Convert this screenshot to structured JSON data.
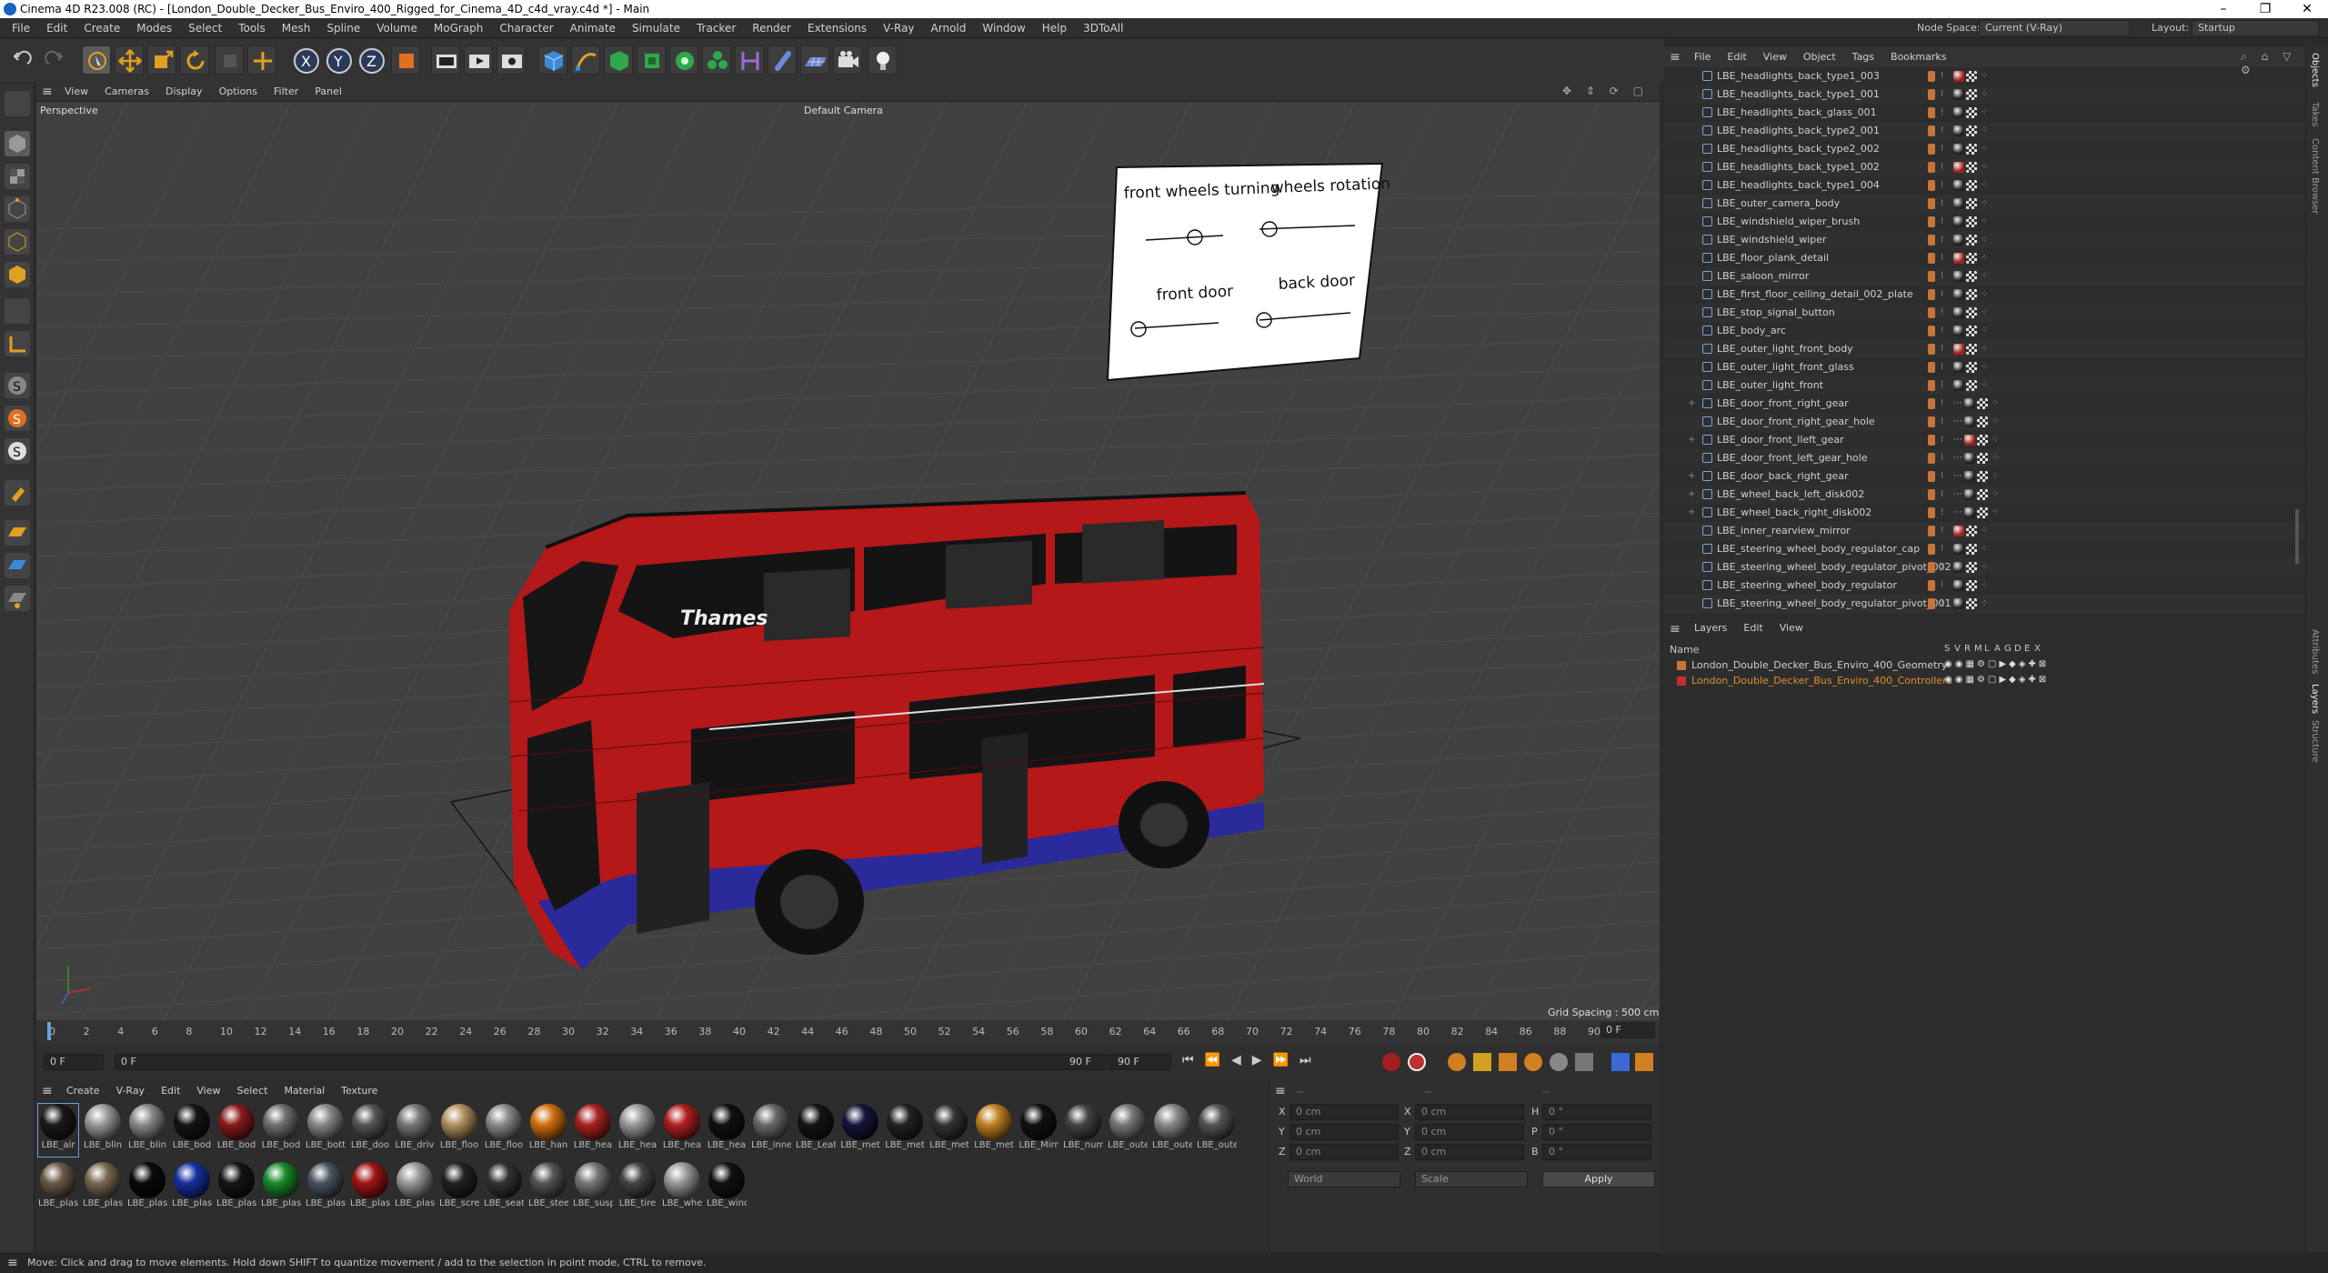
{
  "window": {
    "title": "Cinema 4D R23.008 (RC) - [London_Double_Decker_Bus_Enviro_400_Rigged_for_Cinema_4D_c4d_vray.c4d *] - Main"
  },
  "menubar": [
    "File",
    "Edit",
    "Create",
    "Modes",
    "Select",
    "Tools",
    "Mesh",
    "Spline",
    "Volume",
    "MoGraph",
    "Character",
    "Animate",
    "Simulate",
    "Tracker",
    "Render",
    "Extensions",
    "V-Ray",
    "Arnold",
    "Window",
    "Help",
    "3DToAll"
  ],
  "nodespace": {
    "label": "Node Space:",
    "value": "Current (V-Ray)"
  },
  "layout": {
    "label": "Layout:",
    "value": "Startup"
  },
  "viewport": {
    "menu": [
      "View",
      "Cameras",
      "Display",
      "Options",
      "Filter",
      "Panel"
    ],
    "name": "Perspective",
    "camera": "Default Camera",
    "grid_spacing": "Grid Spacing : 500 cm",
    "controller": {
      "front_wheels": "front wheels turning",
      "wheels_rotation": "wheels rotation",
      "front_door": "front door",
      "back_door": "back door"
    },
    "bus_ad_text": "Thames"
  },
  "timeline": {
    "ticks": [
      "0",
      "2",
      "4",
      "6",
      "8",
      "10",
      "12",
      "14",
      "16",
      "18",
      "20",
      "22",
      "24",
      "26",
      "28",
      "30",
      "32",
      "34",
      "36",
      "38",
      "40",
      "42",
      "44",
      "46",
      "48",
      "50",
      "52",
      "54",
      "56",
      "58",
      "60",
      "62",
      "64",
      "66",
      "68",
      "70",
      "72",
      "74",
      "76",
      "78",
      "80",
      "82",
      "84",
      "86",
      "88",
      "90"
    ],
    "end": "0 F"
  },
  "transport": {
    "current": "0 F",
    "start": "0 F",
    "end1": "90 F",
    "end2": "90 F"
  },
  "materials": {
    "menu": [
      "Create",
      "V-Ray",
      "Edit",
      "View",
      "Select",
      "Material",
      "Texture"
    ],
    "row1": [
      {
        "label": "LBE_air",
        "color": "#1a1a1a"
      },
      {
        "label": "LBE_blin",
        "color": "#9a9a9a"
      },
      {
        "label": "LBE_blin",
        "color": "#8a8a8a"
      },
      {
        "label": "LBE_bod",
        "color": "#151515"
      },
      {
        "label": "LBE_bod",
        "color": "#8a1a1a"
      },
      {
        "label": "LBE_bod",
        "color": "#707070"
      },
      {
        "label": "LBE_bott",
        "color": "#888"
      },
      {
        "label": "LBE_doo",
        "color": "#555"
      },
      {
        "label": "LBE_driv",
        "color": "#777"
      },
      {
        "label": "LBE_floo",
        "color": "#b09060"
      },
      {
        "label": "LBE_floo",
        "color": "#8a8a8a"
      },
      {
        "label": "LBE_han",
        "color": "#d07010"
      },
      {
        "label": "LBE_hea",
        "color": "#aa2222"
      },
      {
        "label": "LBE_hea",
        "color": "#999"
      },
      {
        "label": "LBE_hea",
        "color": "#b02020"
      },
      {
        "label": "LBE_hea",
        "color": "#111"
      },
      {
        "label": "LBE_inne",
        "color": "#6a6a6a"
      },
      {
        "label": "LBE_Leat",
        "color": "#151515"
      },
      {
        "label": "LBE_met",
        "color": "#15153a"
      },
      {
        "label": "LBE_met",
        "color": "#222"
      },
      {
        "label": "LBE_met",
        "color": "#333"
      },
      {
        "label": "LBE_met",
        "color": "#c08020"
      },
      {
        "label": "LBE_Mirr",
        "color": "#111"
      },
      {
        "label": "LBE_num",
        "color": "#444"
      },
      {
        "label": "LBE_oute",
        "color": "#777"
      },
      {
        "label": "LBE_oute",
        "color": "#888"
      },
      {
        "label": "LBE_oute",
        "color": "#555"
      }
    ],
    "row2": [
      {
        "label": "LBE_plas",
        "color": "#6a5a48"
      },
      {
        "label": "LBE_plas",
        "color": "#7a6a50"
      },
      {
        "label": "LBE_plas",
        "color": "#0a0a0a"
      },
      {
        "label": "LBE_plas",
        "color": "#1530a0"
      },
      {
        "label": "LBE_plas",
        "color": "#151515"
      },
      {
        "label": "LBE_plas",
        "color": "#1a8a2a"
      },
      {
        "label": "LBE_plas",
        "color": "#4a5560"
      },
      {
        "label": "LBE_plas",
        "color": "#a01515"
      },
      {
        "label": "LBE_plas",
        "color": "#999"
      },
      {
        "label": "LBE_scre",
        "color": "#222"
      },
      {
        "label": "LBE_seat",
        "color": "#333"
      },
      {
        "label": "LBE_stee",
        "color": "#555"
      },
      {
        "label": "LBE_susp",
        "color": "#777"
      },
      {
        "label": "LBE_tire",
        "color": "#444"
      },
      {
        "label": "LBE_whe",
        "color": "#999"
      },
      {
        "label": "LBE_wind",
        "color": "#111"
      }
    ]
  },
  "coords": {
    "header": [
      "--",
      "--",
      "--"
    ],
    "rows": [
      {
        "a": "X",
        "av": "0 cm",
        "b": "X",
        "bv": "0 cm",
        "c": "H",
        "cv": "0 °"
      },
      {
        "a": "Y",
        "av": "0 cm",
        "b": "Y",
        "bv": "0 cm",
        "c": "P",
        "cv": "0 °"
      },
      {
        "a": "Z",
        "av": "0 cm",
        "b": "Z",
        "bv": "0 cm",
        "c": "B",
        "cv": "0 °"
      }
    ],
    "mode1": "World",
    "mode2": "Scale",
    "apply": "Apply"
  },
  "objects": {
    "menu": [
      "File",
      "Edit",
      "View",
      "Object",
      "Tags",
      "Bookmarks"
    ],
    "items": [
      "LBE_headlights_back_type1_003",
      "LBE_headlights_back_type1_001",
      "LBE_headlights_back_glass_001",
      "LBE_headlights_back_type2_001",
      "LBE_headlights_back_type2_002",
      "LBE_headlights_back_type1_002",
      "LBE_headlights_back_type1_004",
      "LBE_outer_camera_body",
      "LBE_windshield_wiper_brush",
      "LBE_windshield_wiper",
      "LBE_floor_plank_detail",
      "LBE_saloon_mirror",
      "LBE_first_floor_ceiling_detail_002_plate",
      "LBE_stop_signal_button",
      "LBE_body_arc",
      "LBE_outer_light_front_body",
      "LBE_outer_light_front_glass",
      "LBE_outer_light_front",
      "LBE_door_front_right_gear",
      "LBE_door_front_right_gear_hole",
      "LBE_door_front_lleft_gear",
      "LBE_door_front_left_gear_hole",
      "LBE_door_back_right_gear",
      "LBE_wheel_back_left_disk002",
      "LBE_wheel_back_right_disk002",
      "LBE_inner_rearview_mirror",
      "LBE_steering_wheel_body_regulator_cap",
      "LBE_steering_wheel_body_regulator_pivot_002",
      "LBE_steering_wheel_body_regulator",
      "LBE_steering_wheel_body_regulator_pivot_001"
    ]
  },
  "layers": {
    "menu": [
      "Layers",
      "Edit",
      "View"
    ],
    "name_header": "Name",
    "flags": [
      "S",
      "V",
      "R",
      "M",
      "L",
      "A",
      "G",
      "D",
      "E",
      "X"
    ],
    "items": [
      {
        "name": "London_Double_Decker_Bus_Enviro_400_Geometry",
        "color": "#c8733a"
      },
      {
        "name": "London_Double_Decker_Bus_Enviro_400_Controllers",
        "color": "#c03030"
      }
    ]
  },
  "right_tabs": [
    "Objects",
    "Takes",
    "Content Browser",
    "Attributes",
    "Layers",
    "Structure"
  ],
  "status": "Move: Click and drag to move elements. Hold down SHIFT to quantize movement / add to the selection in point mode, CTRL to remove."
}
